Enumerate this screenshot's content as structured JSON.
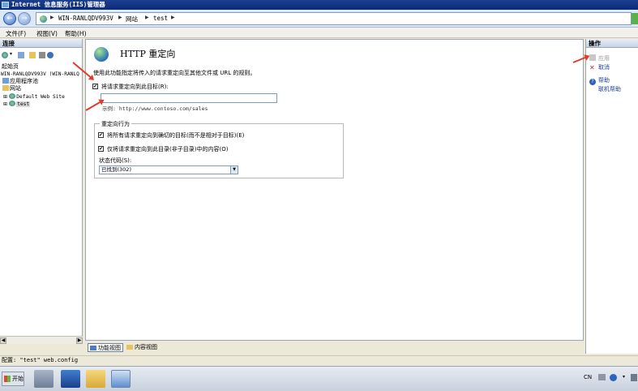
{
  "window": {
    "title": "Internet 信息服务(IIS)管理器"
  },
  "address": {
    "crumbs": [
      "WIN-RANLQDV993V",
      "网站",
      "test"
    ]
  },
  "menu": {
    "file": "文件(F)",
    "view": "视图(V)",
    "help": "帮助(H)"
  },
  "connections": {
    "header": "连接",
    "tree": {
      "start_page": "起始页",
      "server": "WIN-RANLQDV993V (WIN-RANLQ",
      "app_pools": "应用程序池",
      "sites": "网站",
      "default_site": "Default Web Site",
      "test_site": "test"
    }
  },
  "main": {
    "title": "HTTP 重定向",
    "description": "使用此功能指定将传入的请求重定向至其他文件或 URL 的规则。",
    "redirect_checkbox": "将请求重定向到此目标(R):",
    "redirect_target": "",
    "example": "示例: http://www.contoso.com/sales",
    "behavior_group": "重定向行为",
    "exact_destination": "将所有请求重定向到确切的目标(而不是相对于目标)(E)",
    "only_this_dir": "仅将请求重定向到此目录(非子目录)中的内容(O)",
    "status_label": "状态代码(S):",
    "status_value": "已找到(302)"
  },
  "tabs": {
    "features": "功能视图",
    "content": "内容视图"
  },
  "actions": {
    "header": "操作",
    "apply": "应用",
    "cancel": "取消",
    "help": "帮助",
    "online_help": "联机帮助"
  },
  "status": {
    "text": "配置: \"test\" web.config"
  },
  "taskbar": {
    "start": "开始",
    "lang": "CN"
  },
  "colors": {
    "accent": "#1c3f8f",
    "annotation": "#e23b2b"
  }
}
